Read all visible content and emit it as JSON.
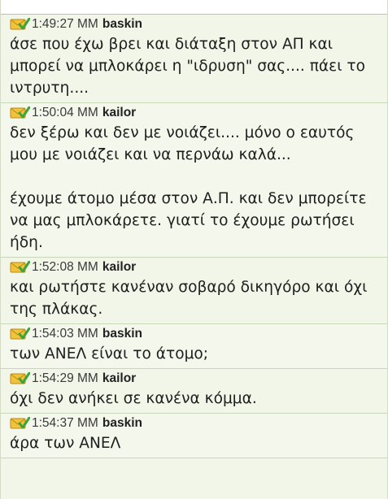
{
  "messages": [
    {
      "icon": "envelope-check-icon",
      "time": "1:49:27 MM",
      "user": "baskin",
      "text": "άσε που έχω βρει και διάταξη στον ΑΠ και μπορεί να μπλοκάρει η \"ιδρυση\" σας.... πάει το ιντρυτη...."
    },
    {
      "icon": "envelope-check-icon",
      "time": "1:50:04 MM",
      "user": "kailor",
      "text": "δεν ξέρω και δεν με νοιάζει.... μόνο ο εαυτός μου με νοιάζει και να περνάω καλά...\n\nέχουμε άτομο μέσα στον Α.Π. και δεν μπορείτε να μας μπλοκάρετε. γιατί το έχουμε ρωτήσει ήδη."
    },
    {
      "icon": "envelope-check-icon",
      "time": "1:52:08 MM",
      "user": "kailor",
      "text": "και ρωτήστε κανέναν σοβαρό δικηγόρο και όχι της πλάκας."
    },
    {
      "icon": "envelope-check-icon",
      "time": "1:54:03 MM",
      "user": "baskin",
      "text": "των ΑΝΕΛ είναι το άτομο;"
    },
    {
      "icon": "envelope-check-icon",
      "time": "1:54:29 MM",
      "user": "kailor",
      "text": "όχι δεν ανήκει σε κανένα κόμμα."
    },
    {
      "icon": "envelope-check-icon",
      "time": "1:54:37 MM",
      "user": "baskin",
      "text": "άρα των ΑΝΕΛ"
    }
  ],
  "colors": {
    "row_background": "#f1f6e8",
    "divider": "#c9d6b8",
    "envelope": "#f2c23a",
    "check": "#3da33a"
  }
}
